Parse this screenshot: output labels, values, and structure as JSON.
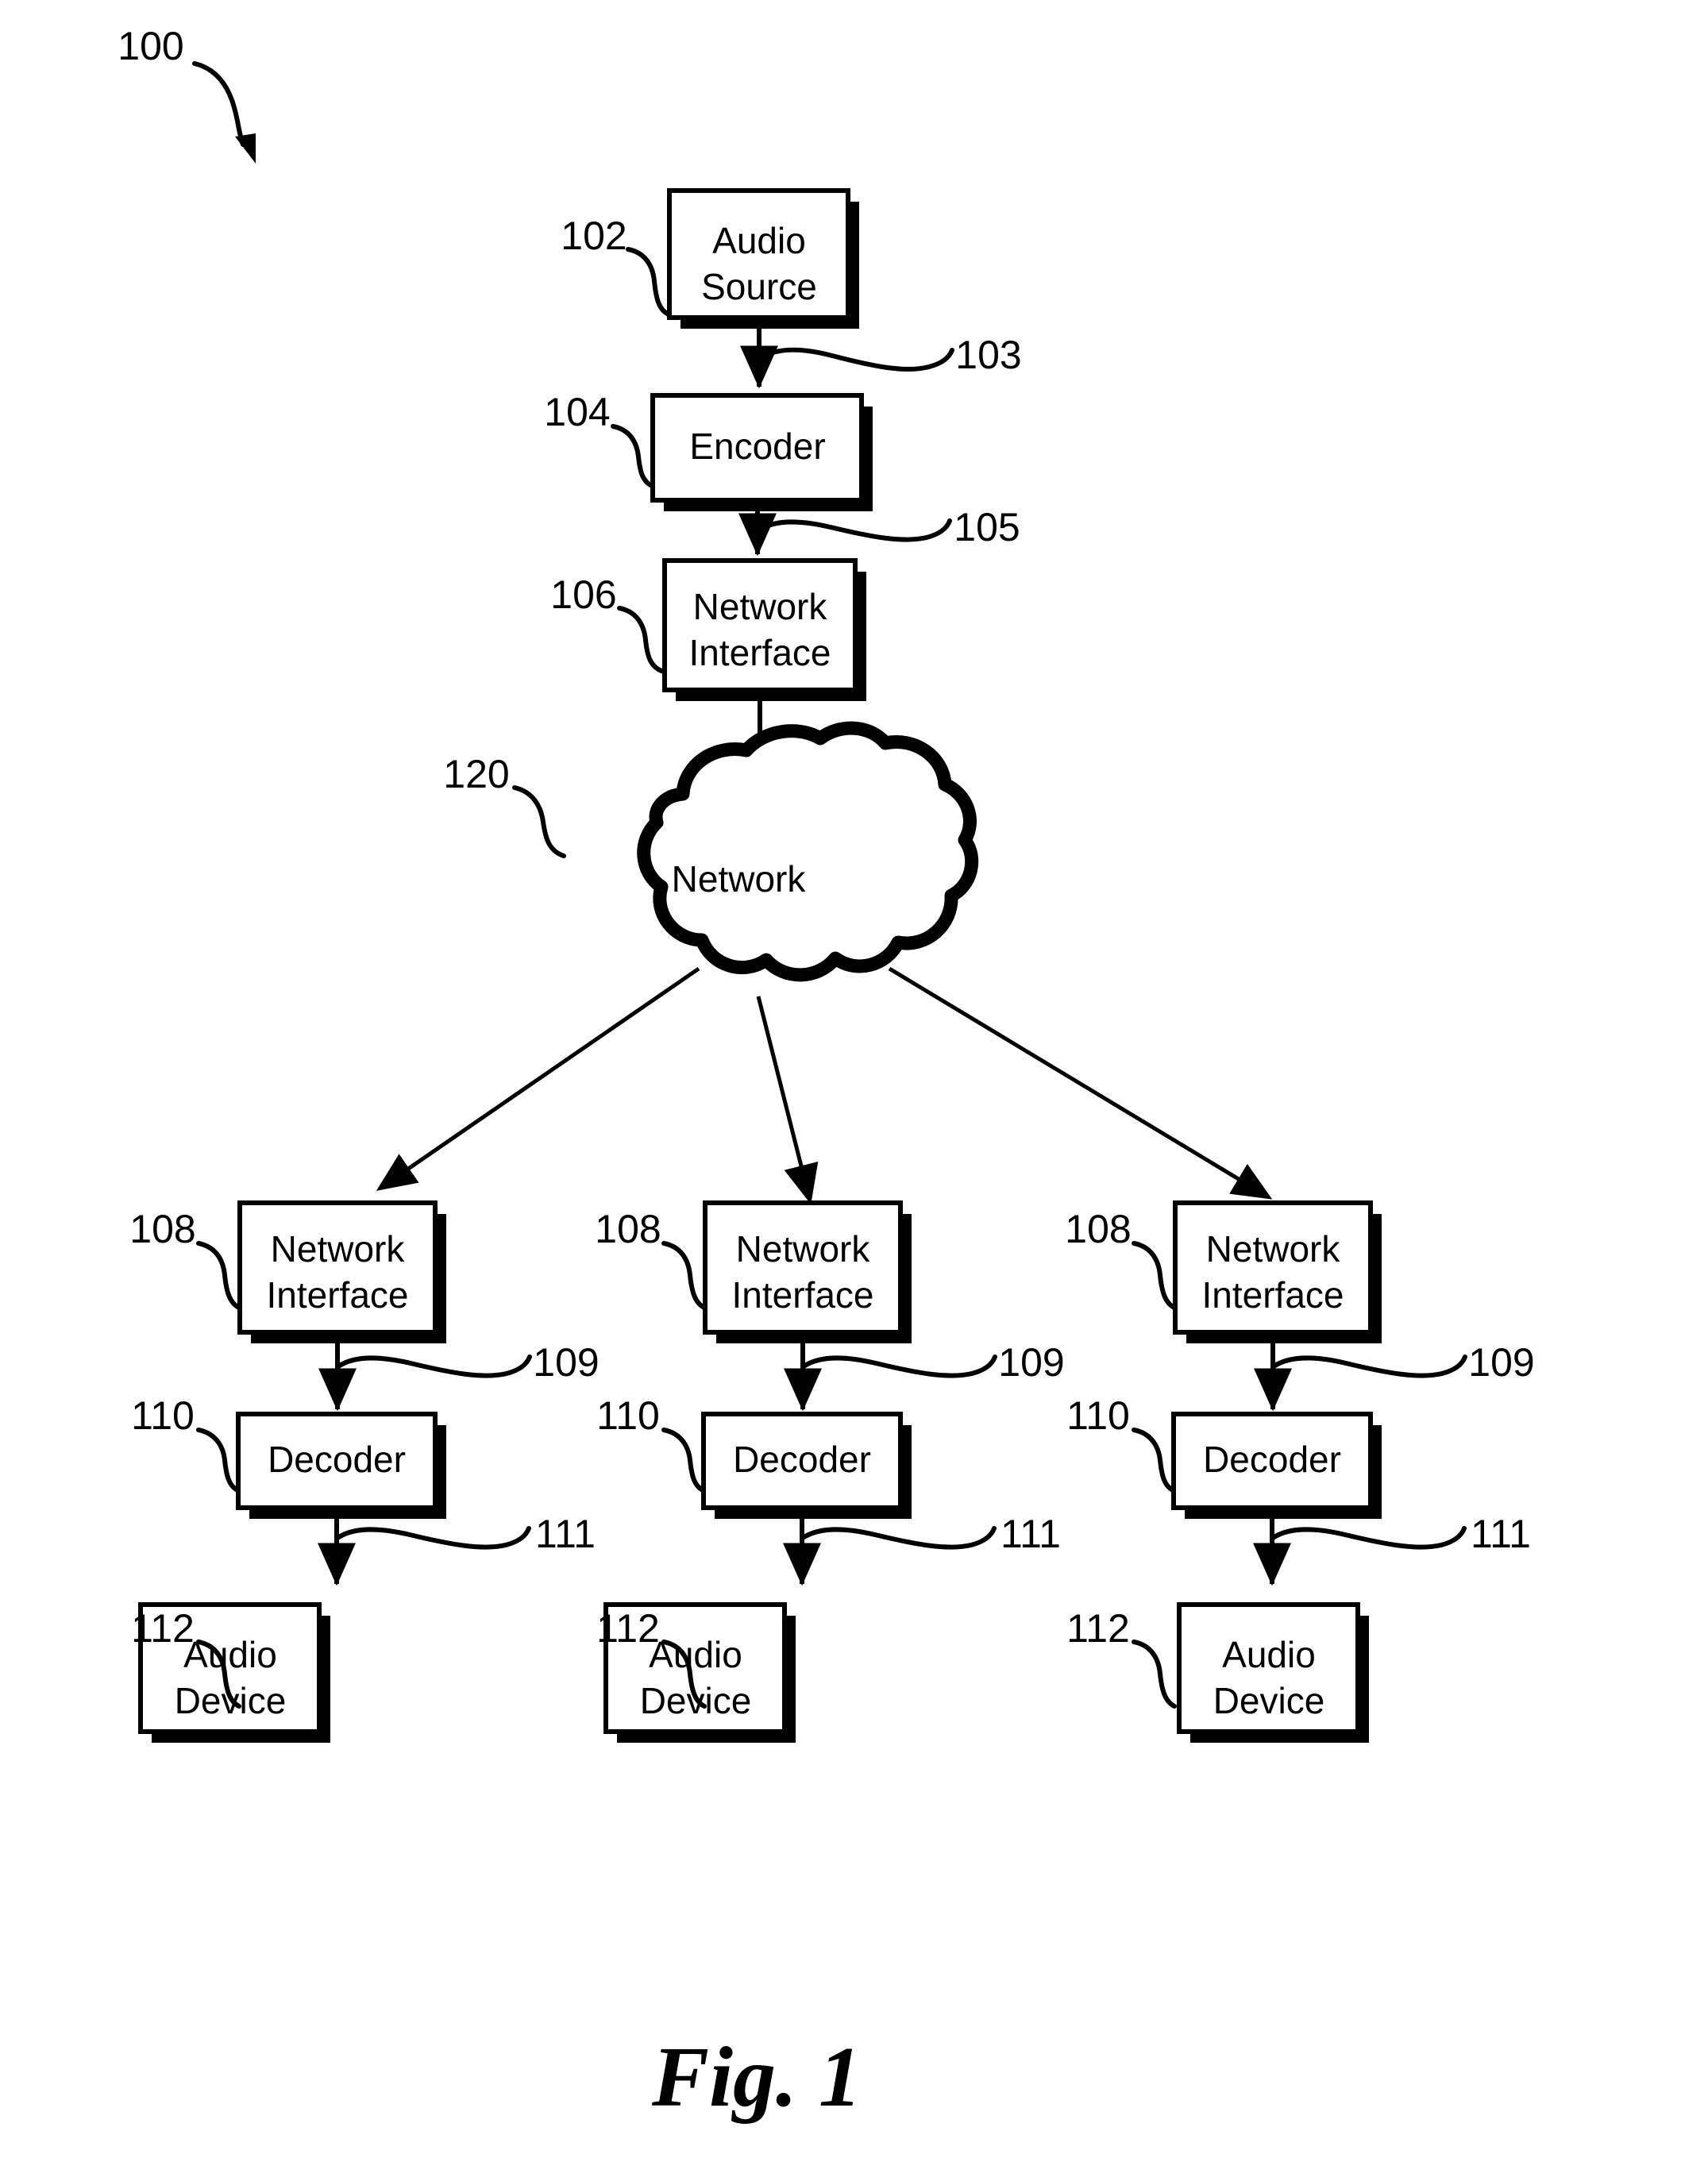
{
  "figure": {
    "caption": "Fig. 1",
    "system_ref": "100"
  },
  "nodes": {
    "audio_source": {
      "label_line1": "Audio",
      "label_line2": "Source",
      "ref": "102"
    },
    "encoder": {
      "label_line1": "Encoder",
      "ref": "104"
    },
    "source_network_interface": {
      "label_line1": "Network",
      "label_line2": "Interface",
      "ref": "106"
    },
    "network_cloud": {
      "label_line1": "Network",
      "ref": "120"
    }
  },
  "signals": {
    "source_to_encoder": "103",
    "encoder_to_interface": "105"
  },
  "branches": [
    {
      "network_interface": {
        "label_line1": "Network",
        "label_line2": "Interface",
        "ref": "108"
      },
      "interface_to_decoder": "109",
      "decoder": {
        "label_line1": "Decoder",
        "ref": "110"
      },
      "decoder_to_device": "111",
      "audio_device": {
        "label_line1": "Audio",
        "label_line2": "Device",
        "ref": "112"
      }
    },
    {
      "network_interface": {
        "label_line1": "Network",
        "label_line2": "Interface",
        "ref": "108"
      },
      "interface_to_decoder": "109",
      "decoder": {
        "label_line1": "Decoder",
        "ref": "110"
      },
      "decoder_to_device": "111",
      "audio_device": {
        "label_line1": "Audio",
        "label_line2": "Device",
        "ref": "112"
      }
    },
    {
      "network_interface": {
        "label_line1": "Network",
        "label_line2": "Interface",
        "ref": "108"
      },
      "interface_to_decoder": "109",
      "decoder": {
        "label_line1": "Decoder",
        "ref": "110"
      },
      "decoder_to_device": "111",
      "audio_device": {
        "label_line1": "Audio",
        "label_line2": "Device",
        "ref": "112"
      }
    }
  ],
  "colors": {
    "ink": "#000000",
    "paper": "#ffffff"
  }
}
